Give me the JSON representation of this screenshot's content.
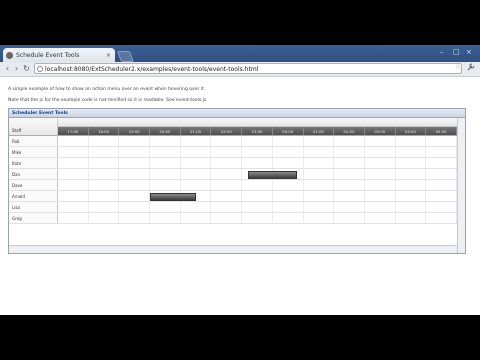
{
  "browser": {
    "tab_title": "Schedule Event Tools",
    "tab_close": "×",
    "window_controls": [
      "–",
      "□",
      "×"
    ],
    "url": "localhost:8080/ExtScheduler2.x/examples/event-tools/event-tools.html",
    "back_icon": "‹",
    "forward_icon": "›",
    "reload_icon": "↻",
    "star_icon": "☆",
    "wrench_icon": "🔧"
  },
  "page": {
    "paragraph1": "A simple example of how to show an action menu over an event when hovering over it.",
    "paragraph2": "Note that the js for the example code is not minified so it is readable. See event-tools.js."
  },
  "scheduler": {
    "title": "Scheduler Event Tools",
    "resource_header": "Staff",
    "date_header": "",
    "time_columns": [
      "17:00",
      "18:00",
      "19:00",
      "20:00",
      "21:00",
      "22:00",
      "23:00",
      "00:00",
      "01:00",
      "02:00",
      "03:00",
      "04:00",
      "05:00"
    ],
    "resources": [
      "Rob",
      "Mike",
      "Kate",
      "Dan",
      "Dave",
      "Arnold",
      "Lisa",
      "Greg"
    ],
    "events": [
      {
        "resource_index": 3,
        "start_col": 6.2,
        "end_col": 7.8,
        "label": ""
      },
      {
        "resource_index": 5,
        "start_col": 3.0,
        "end_col": 4.5,
        "label": ""
      }
    ]
  }
}
